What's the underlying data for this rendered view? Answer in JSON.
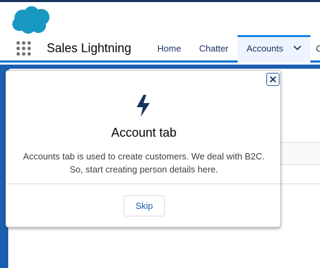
{
  "app": {
    "name": "Sales Lightning",
    "logo_icon": "salesforce-cloud-icon",
    "logo_color": "#1798c1"
  },
  "nav": {
    "items": [
      {
        "label": "Home",
        "active": false
      },
      {
        "label": "Chatter",
        "active": false
      },
      {
        "label": "Accounts",
        "active": true
      }
    ],
    "more_label": "C"
  },
  "popover": {
    "icon": "lightning-bolt-icon",
    "title": "Account tab",
    "body_line1": "Accounts tab is used to create customers. We deal with B2C.",
    "body_line2": "So, start creating person details here.",
    "skip_label": "Skip",
    "close_icon": "close-icon"
  },
  "colors": {
    "brand_blue": "#0070d2",
    "navy": "#16325c",
    "background_blue": "#1b5fb0"
  }
}
